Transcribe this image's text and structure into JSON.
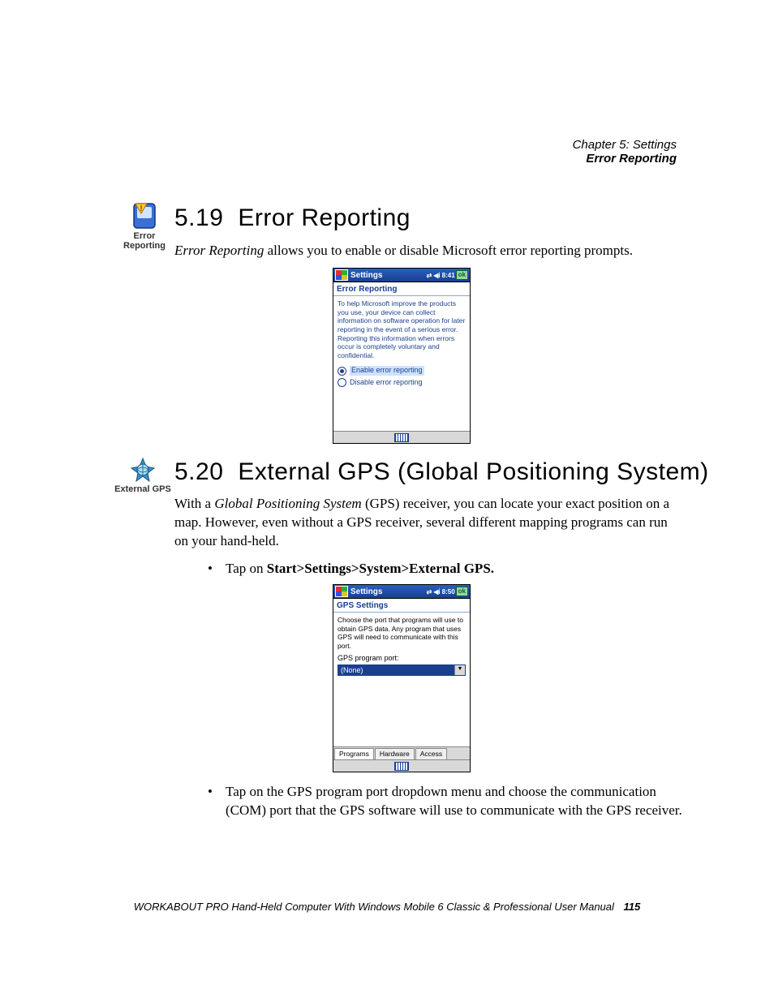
{
  "header": {
    "chapter": "Chapter 5: Settings",
    "section": "Error Reporting"
  },
  "icons": {
    "error_reporting_label_l1": "Error",
    "error_reporting_label_l2": "Reporting",
    "external_gps_label": "External GPS"
  },
  "sec519": {
    "num": "5.19",
    "title": "Error Reporting",
    "intro_lead": "Error Reporting",
    "intro_rest": " allows you to enable or disable Microsoft error reporting prompts."
  },
  "wm1": {
    "title": "Settings",
    "time": "8:41",
    "ok": "ok",
    "subhead": "Error Reporting",
    "desc": "To help Microsoft improve the products you use, your device can collect information on software operation for later reporting in the event of a serious error. Reporting this information when errors occur is completely voluntary and confidential.",
    "opt_enable": "Enable error reporting",
    "opt_disable": "Disable error reporting"
  },
  "sec520": {
    "num": "5.20",
    "title": "External GPS (Global Positioning System)",
    "para_pre": "With a ",
    "para_em": "Global Positioning System",
    "para_post": " (GPS) receiver, you can locate your exact position on a map. However, even without a GPS receiver, several different mapping programs can run on your hand-held.",
    "bullet1_pre": "Tap on ",
    "bullet1_strong": "Start>Settings>System>External GPS.",
    "bullet2_pre": "Tap on the ",
    "bullet2_em": "GPS program port",
    "bullet2_post": " dropdown menu and choose the communication (COM) port that the GPS software will use to communicate with the GPS receiver."
  },
  "wm2": {
    "title": "Settings",
    "time": "8:50",
    "ok": "ok",
    "subhead": "GPS Settings",
    "desc": "Choose the port that programs will use to obtain GPS data. Any program that uses GPS will need to communicate with this port.",
    "field_label": "GPS program port:",
    "dropdown_value": "(None)",
    "tabs": {
      "programs": "Programs",
      "hardware": "Hardware",
      "access": "Access"
    }
  },
  "footer": {
    "text": "WORKABOUT PRO Hand-Held Computer With Windows Mobile 6 Classic & Professional User Manual",
    "page": "115"
  }
}
